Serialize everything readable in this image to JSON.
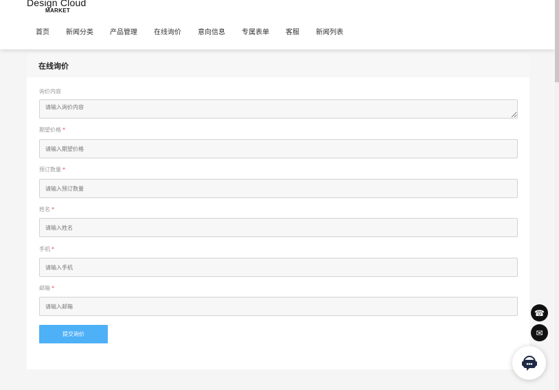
{
  "logo": {
    "main": "Design Cloud",
    "sub": "MARKET"
  },
  "nav": [
    {
      "label": "首页"
    },
    {
      "label": "新闻分类"
    },
    {
      "label": "产品管理"
    },
    {
      "label": "在线询价"
    },
    {
      "label": "意向信息"
    },
    {
      "label": "专属表单"
    },
    {
      "label": "客服"
    },
    {
      "label": "新闻列表"
    }
  ],
  "form": {
    "title": "在线询价",
    "fields": {
      "content": {
        "label": "询价内容",
        "placeholder": "请输入询价内容"
      },
      "price": {
        "label": "期望价格",
        "required": "*",
        "placeholder": "请输入期望价格"
      },
      "quantity": {
        "label": "预订数量",
        "required": "*",
        "placeholder": "请输入预订数量"
      },
      "name": {
        "label": "姓名",
        "required": "*",
        "placeholder": "请输入姓名"
      },
      "phone": {
        "label": "手机",
        "required": "*",
        "placeholder": "请输入手机"
      },
      "email": {
        "label": "邮箱",
        "required": "*",
        "placeholder": "请输入邮箱"
      }
    },
    "submit_label": "提交询价"
  },
  "floating": {
    "phone_icon": "☎",
    "mail_icon": "✉"
  },
  "icons": {
    "phone": "phone-icon",
    "mail": "mail-icon",
    "chat": "chat-icon"
  },
  "colors": {
    "accent": "#4eb0f7",
    "required": "#e5534b",
    "float": "#111111"
  }
}
